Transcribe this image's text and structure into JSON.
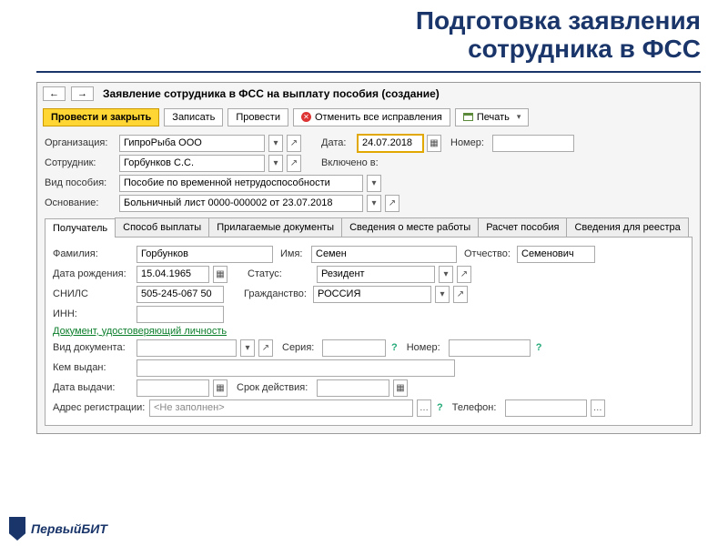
{
  "slide": {
    "title_line1": "Подготовка заявления",
    "title_line2": "сотрудника в ФСС"
  },
  "window": {
    "title": "Заявление сотрудника в ФСС на выплату пособия (создание)",
    "nav_back": "←",
    "nav_fwd": "→"
  },
  "toolbar": {
    "submit_close": "Провести и закрыть",
    "save": "Записать",
    "submit": "Провести",
    "cancel_fixes": "Отменить все исправления",
    "print": "Печать"
  },
  "fields": {
    "org_label": "Организация:",
    "org_value": "ГипроРыба ООО",
    "date_label": "Дата:",
    "date_value": "24.07.2018",
    "number_label": "Номер:",
    "number_value": "",
    "employee_label": "Сотрудник:",
    "employee_value": "Горбунков С.С.",
    "included_label": "Включено в:",
    "benefit_type_label": "Вид пособия:",
    "benefit_type_value": "Пособие по временной нетрудоспособности",
    "basis_label": "Основание:",
    "basis_value": "Больничный лист 0000-000002 от 23.07.2018"
  },
  "tabs": {
    "t0": "Получатель",
    "t1": "Способ выплаты",
    "t2": "Прилагаемые документы",
    "t3": "Сведения о месте работы",
    "t4": "Расчет пособия",
    "t5": "Сведения для реестра"
  },
  "recipient": {
    "lastname_label": "Фамилия:",
    "lastname_value": "Горбунков",
    "firstname_label": "Имя:",
    "firstname_value": "Семен",
    "patronymic_label": "Отчество:",
    "patronymic_value": "Семенович",
    "dob_label": "Дата рождения:",
    "dob_value": "15.04.1965",
    "status_label": "Статус:",
    "status_value": "Резидент",
    "snils_label": "СНИЛС",
    "snils_value": "505-245-067 50",
    "citizenship_label": "Гражданство:",
    "citizenship_value": "РОССИЯ",
    "inn_label": "ИНН:",
    "inn_value": "",
    "id_doc_link": "Документ, удостоверяющий личность",
    "doc_type_label": "Вид документа:",
    "doc_series_label": "Серия:",
    "doc_number_label": "Номер:",
    "issued_by_label": "Кем выдан:",
    "issue_date_label": "Дата выдачи:",
    "expiry_label": "Срок действия:",
    "reg_address_label": "Адрес регистрации:",
    "reg_address_placeholder": "<Не заполнен>",
    "phone_label": "Телефон:"
  },
  "footer": {
    "brand": "ПервыйБИТ"
  }
}
